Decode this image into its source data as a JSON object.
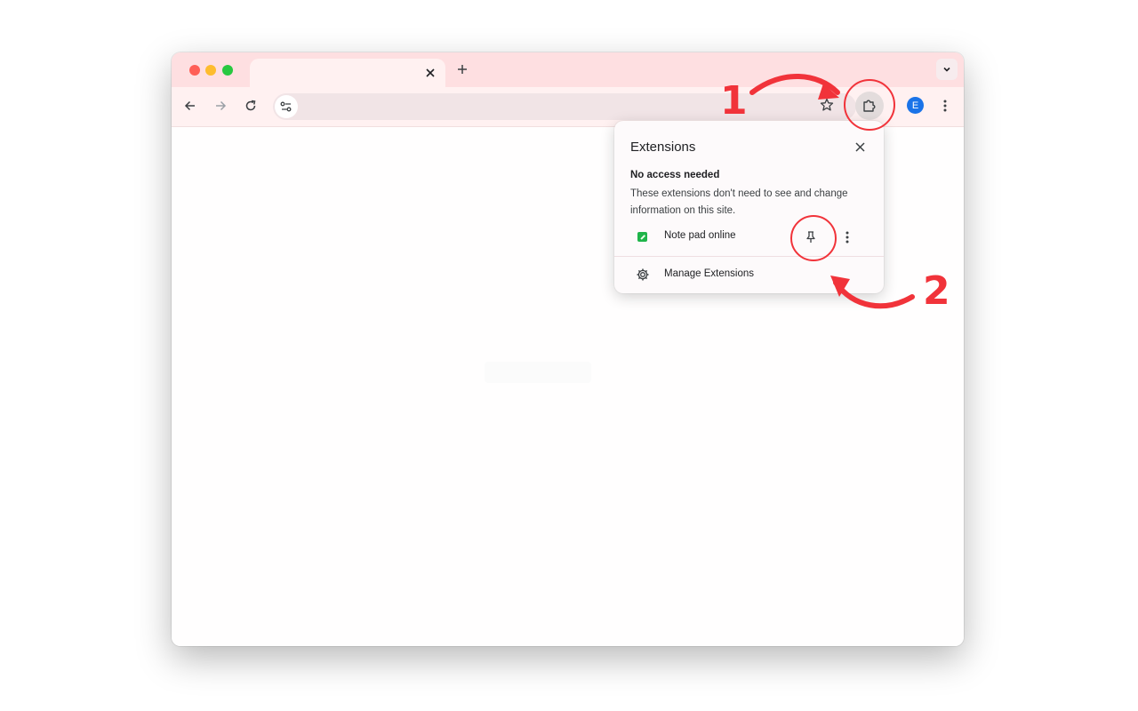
{
  "browser": {
    "tab_close_glyph": "✕",
    "newtab_glyph": "+",
    "avatar_initial": "E"
  },
  "popup": {
    "title": "Extensions",
    "section_heading": "No access needed",
    "section_description": "These extensions don't need to see and change information on this site.",
    "extension_name": "Note pad online",
    "manage_label": "Manage Extensions"
  },
  "annotations": {
    "step1": "1",
    "step2": "2"
  },
  "colors": {
    "tab_strip": "#fedfe1",
    "annotation_red": "#f1333a",
    "extension_green": "#1fb44a",
    "avatar_blue": "#1a73e8"
  },
  "icons": [
    "back-icon",
    "forward-icon",
    "reload-icon",
    "site-info-icon",
    "star-icon",
    "puzzle-icon",
    "kebab-icon",
    "close-icon",
    "pin-icon",
    "gear-icon",
    "chevron-down-icon",
    "plus-icon"
  ]
}
